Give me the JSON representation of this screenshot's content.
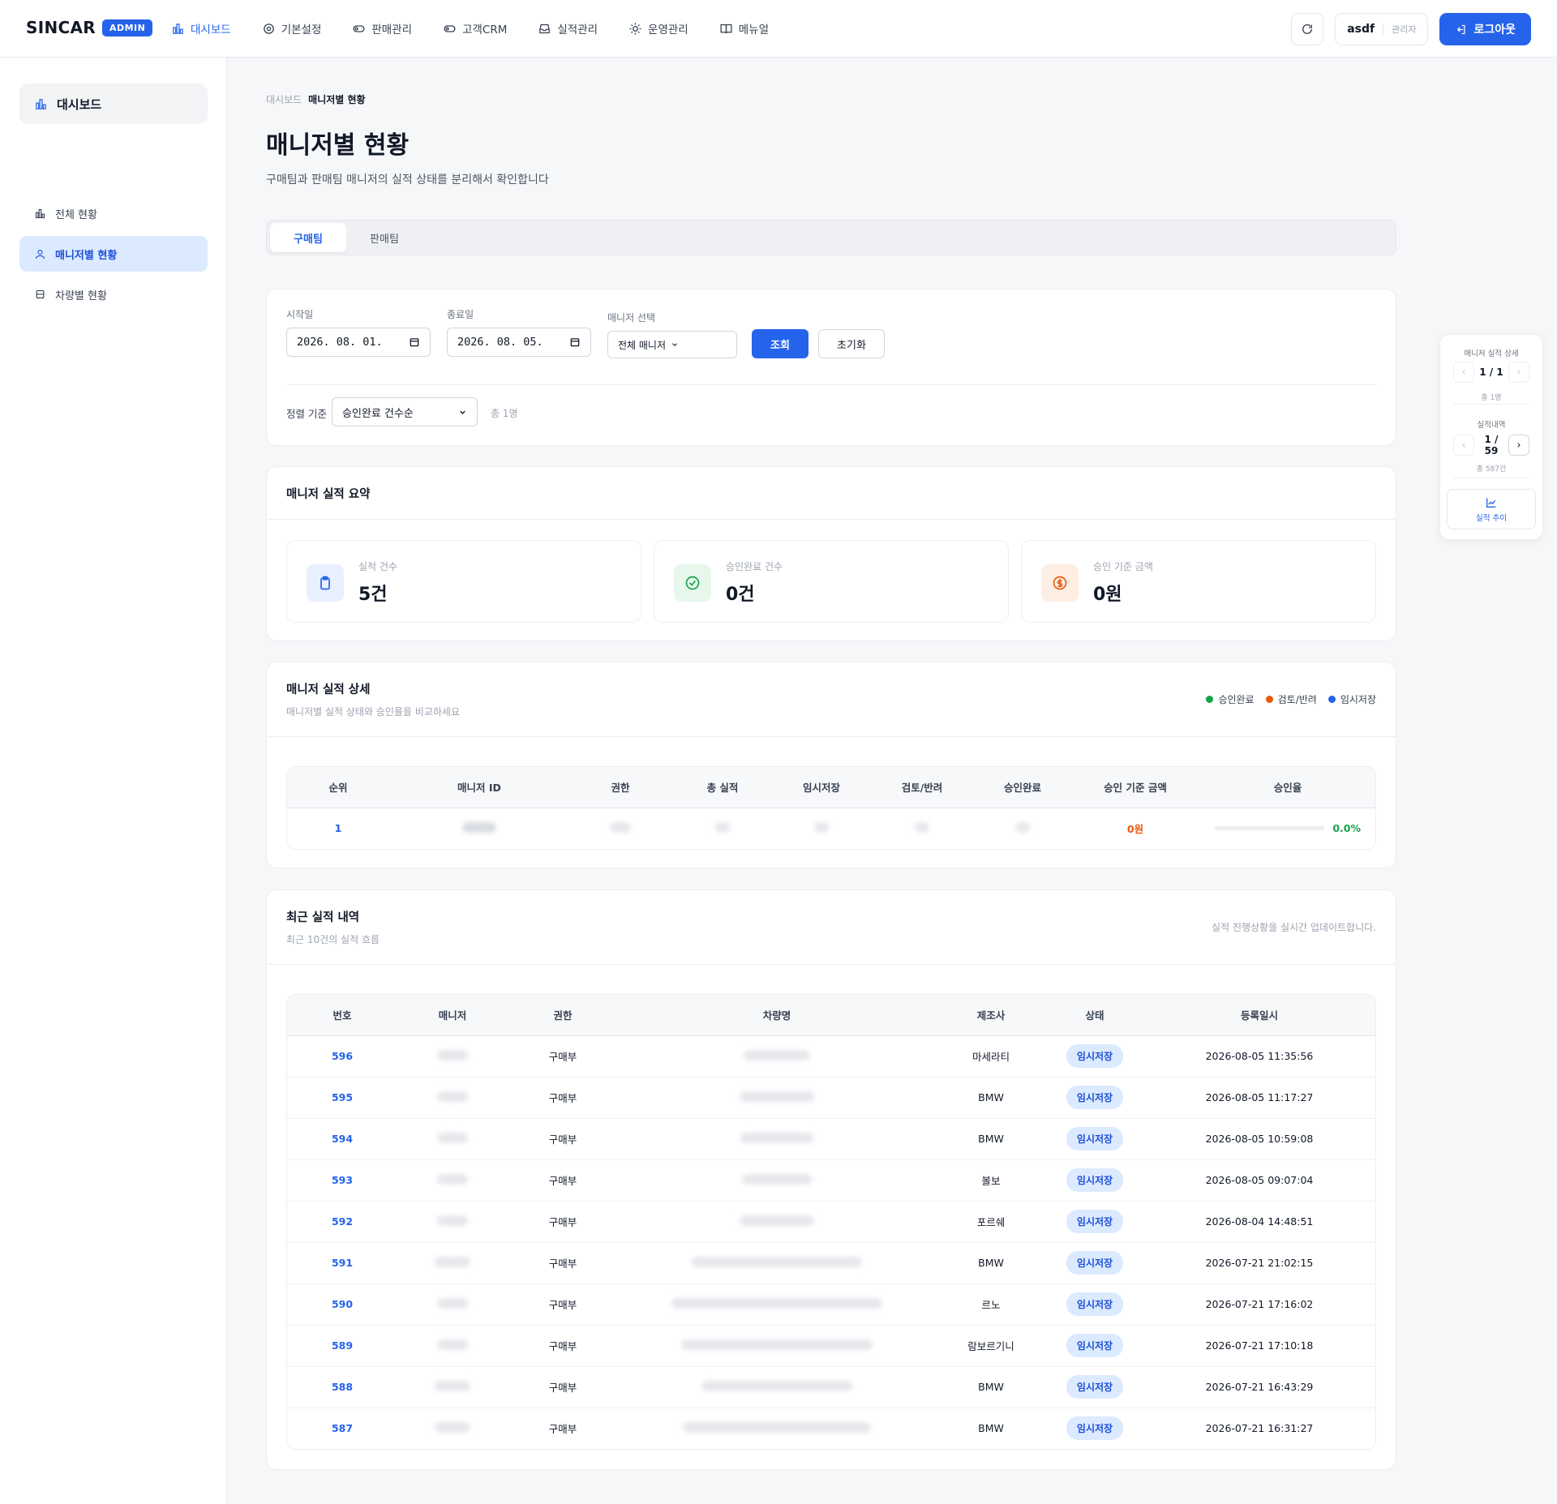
{
  "header": {
    "logo": "SINCAR",
    "badge": "ADMIN",
    "nav": [
      {
        "label": "대시보드",
        "icon": "bar-chart-icon"
      },
      {
        "label": "기본설정",
        "icon": "target-icon"
      },
      {
        "label": "판매관리",
        "icon": "toggle-icon"
      },
      {
        "label": "고객CRM",
        "icon": "toggle-icon"
      },
      {
        "label": "실적관리",
        "icon": "inbox-icon"
      },
      {
        "label": "운영관리",
        "icon": "sun-icon"
      },
      {
        "label": "메뉴얼",
        "icon": "book-icon"
      }
    ],
    "user_name": "asdf",
    "user_role": "관리자",
    "logout_label": "로그아웃"
  },
  "sidebar": {
    "title": "대시보드",
    "items": [
      {
        "label": "전체 현황",
        "icon": "bar-chart-icon"
      },
      {
        "label": "매니저별 현황",
        "icon": "user-icon"
      },
      {
        "label": "차량별 현황",
        "icon": "car-icon"
      }
    ]
  },
  "breadcrumb": {
    "parent": "대시보드",
    "current": "매니저별 현황"
  },
  "page": {
    "title": "매니저별 현황",
    "subtitle": "구매팀과 판매팀 매니저의 실적 상태를 분리해서 확인합니다"
  },
  "tabs": [
    "구매팀",
    "판매팀"
  ],
  "filters": {
    "start_label": "시작일",
    "start_value": "2026. 08. 01.",
    "end_label": "종료일",
    "end_value": "2026. 08. 05.",
    "manager_label": "매니저 선택",
    "manager_value": "전체 매니저",
    "search_label": "조회",
    "reset_label": "초기화",
    "sort_label": "정렬 기준",
    "sort_value": "승인완료 건수순",
    "total_text": "총 1명"
  },
  "summary": {
    "title": "매니저 실적 요약",
    "stats": [
      {
        "label": "실적 건수",
        "value": "5건",
        "icon": "clipboard-icon",
        "color": "#2563eb"
      },
      {
        "label": "승인완료 건수",
        "value": "0건",
        "icon": "check-circle-icon",
        "color": "#16a34a"
      },
      {
        "label": "승인 기준 금액",
        "value": "0원",
        "icon": "dollar-circle-icon",
        "color": "#ea580c"
      }
    ]
  },
  "detail": {
    "title": "매니저 실적 상세",
    "subtitle": "매니저별 실적 상태와 승인율을 비교하세요",
    "legend": [
      {
        "label": "승인완료",
        "color": "#16a34a"
      },
      {
        "label": "검토/반려",
        "color": "#ea580c"
      },
      {
        "label": "임시저장",
        "color": "#2563eb"
      }
    ],
    "columns": [
      "순위",
      "매니저 ID",
      "권한",
      "총 실적",
      "임시저장",
      "검토/반려",
      "승인완료",
      "승인 기준 금액",
      "승인율"
    ],
    "rows": [
      {
        "rank": "1",
        "amount": "0원",
        "rate_text": "0.0%",
        "rate": 0.0
      }
    ]
  },
  "recent": {
    "title": "최근 실적 내역",
    "subtitle": "최근 10건의 실적 흐름",
    "note": "실적 진행상황을 실시간 업데이트합니다.",
    "columns": [
      "번호",
      "매니저",
      "권한",
      "차량명",
      "제조사",
      "상태",
      "등록일시"
    ],
    "rows": [
      {
        "no": "596",
        "role": "구매부",
        "maker": "마세라티",
        "status": "임시저장",
        "date": "2026-08-05 11:35:56"
      },
      {
        "no": "595",
        "role": "구매부",
        "maker": "BMW",
        "status": "임시저장",
        "date": "2026-08-05 11:17:27"
      },
      {
        "no": "594",
        "role": "구매부",
        "maker": "BMW",
        "status": "임시저장",
        "date": "2026-08-05 10:59:08"
      },
      {
        "no": "593",
        "role": "구매부",
        "maker": "볼보",
        "status": "임시저장",
        "date": "2026-08-05 09:07:04"
      },
      {
        "no": "592",
        "role": "구매부",
        "maker": "포르쉐",
        "status": "임시저장",
        "date": "2026-08-04 14:48:51"
      },
      {
        "no": "591",
        "role": "구매부",
        "maker": "BMW",
        "status": "임시저장",
        "date": "2026-07-21 21:02:15"
      },
      {
        "no": "590",
        "role": "구매부",
        "maker": "르노",
        "status": "임시저장",
        "date": "2026-07-21 17:16:02"
      },
      {
        "no": "589",
        "role": "구매부",
        "maker": "람보르기니",
        "status": "임시저장",
        "date": "2026-07-21 17:10:18"
      },
      {
        "no": "588",
        "role": "구매부",
        "maker": "BMW",
        "status": "임시저장",
        "date": "2026-07-21 16:43:29"
      },
      {
        "no": "587",
        "role": "구매부",
        "maker": "BMW",
        "status": "임시저장",
        "date": "2026-07-21 16:31:27"
      }
    ]
  },
  "floating": {
    "detail_label": "매니저 실적 상세",
    "detail_page": "1 / 1",
    "detail_count": "총 1명",
    "history_label": "실적내역",
    "history_page": "1 / 59",
    "history_count": "총 587건",
    "trend_label": "실적 추이"
  }
}
